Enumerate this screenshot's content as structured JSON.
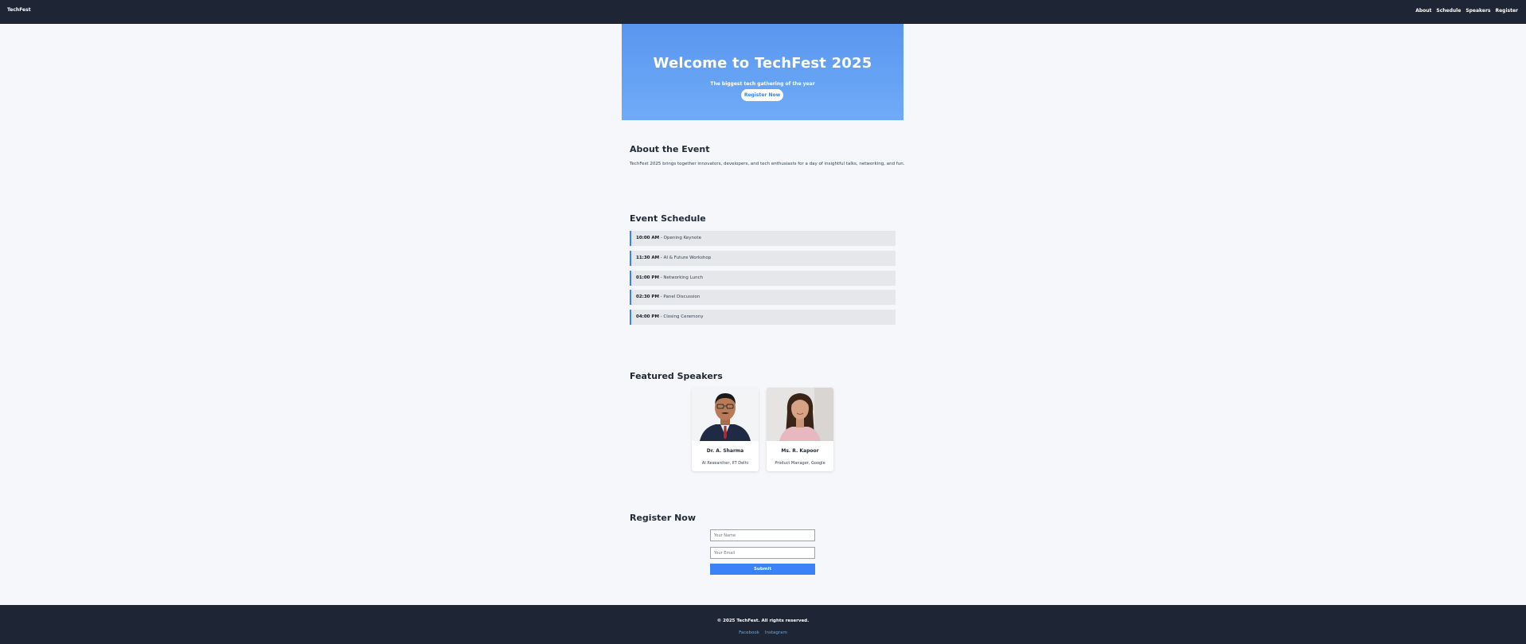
{
  "nav": {
    "brand": "TechFest",
    "links": [
      "About",
      "Schedule",
      "Speakers",
      "Register"
    ]
  },
  "hero": {
    "title": "Welcome to TechFest 2025",
    "subtitle": "The biggest tech gathering of the year",
    "cta": "Register Now"
  },
  "about": {
    "title": "About the Event",
    "text": "TechFest 2025 brings together innovators, developers, and tech enthusiasts for a day of insightful talks, networking, and fun."
  },
  "schedule": {
    "title": "Event Schedule",
    "items": [
      {
        "time": "10:00 AM",
        "event": "Opening Keynote"
      },
      {
        "time": "11:30 AM",
        "event": "AI & Future Workshop"
      },
      {
        "time": "01:00 PM",
        "event": "Networking Lunch"
      },
      {
        "time": "02:30 PM",
        "event": "Panel Discussion"
      },
      {
        "time": "04:00 PM",
        "event": "Closing Ceremony"
      }
    ]
  },
  "speakers": {
    "title": "Featured Speakers",
    "items": [
      {
        "name": "Dr. A. Sharma",
        "role": "AI Researcher, IIT Delhi"
      },
      {
        "name": "Ms. R. Kapoor",
        "role": "Product Manager, Google"
      }
    ]
  },
  "register": {
    "title": "Register Now",
    "name_placeholder": "Your Name",
    "email_placeholder": "Your Email",
    "submit": "Submit"
  },
  "footer": {
    "copyright": "© 2025 TechFest. All rights reserved.",
    "links": [
      "Facebook",
      "Instagram"
    ]
  },
  "colors": {
    "nav_bg": "#1e2636",
    "accent": "#3b82f6",
    "hero_gradient_top": "#5a96f0",
    "hero_gradient_bottom": "#6fabf6"
  }
}
